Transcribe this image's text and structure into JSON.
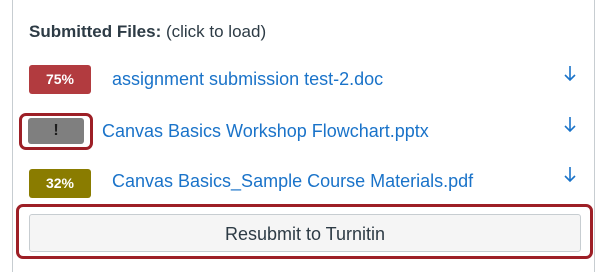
{
  "panel": {
    "header_bold": "Submitted Files:",
    "header_note": "(click to load)"
  },
  "files": [
    {
      "badge": "75%",
      "badge_color": "#b23b3f",
      "name": "assignment submission test-2.doc",
      "download_icon": "download-arrow-icon"
    },
    {
      "badge": "!",
      "badge_color": "#7f7f7f",
      "name": "Canvas Basics Workshop Flowchart.pptx",
      "download_icon": "download-arrow-icon"
    },
    {
      "badge": "32%",
      "badge_color": "#8a7c00",
      "name": "Canvas Basics_Sample Course Materials.pdf",
      "download_icon": "download-arrow-icon"
    }
  ],
  "actions": {
    "resubmit_label": "Resubmit to Turnitin"
  },
  "colors": {
    "link": "#1a73c9",
    "highlight": "#9d1f26"
  }
}
